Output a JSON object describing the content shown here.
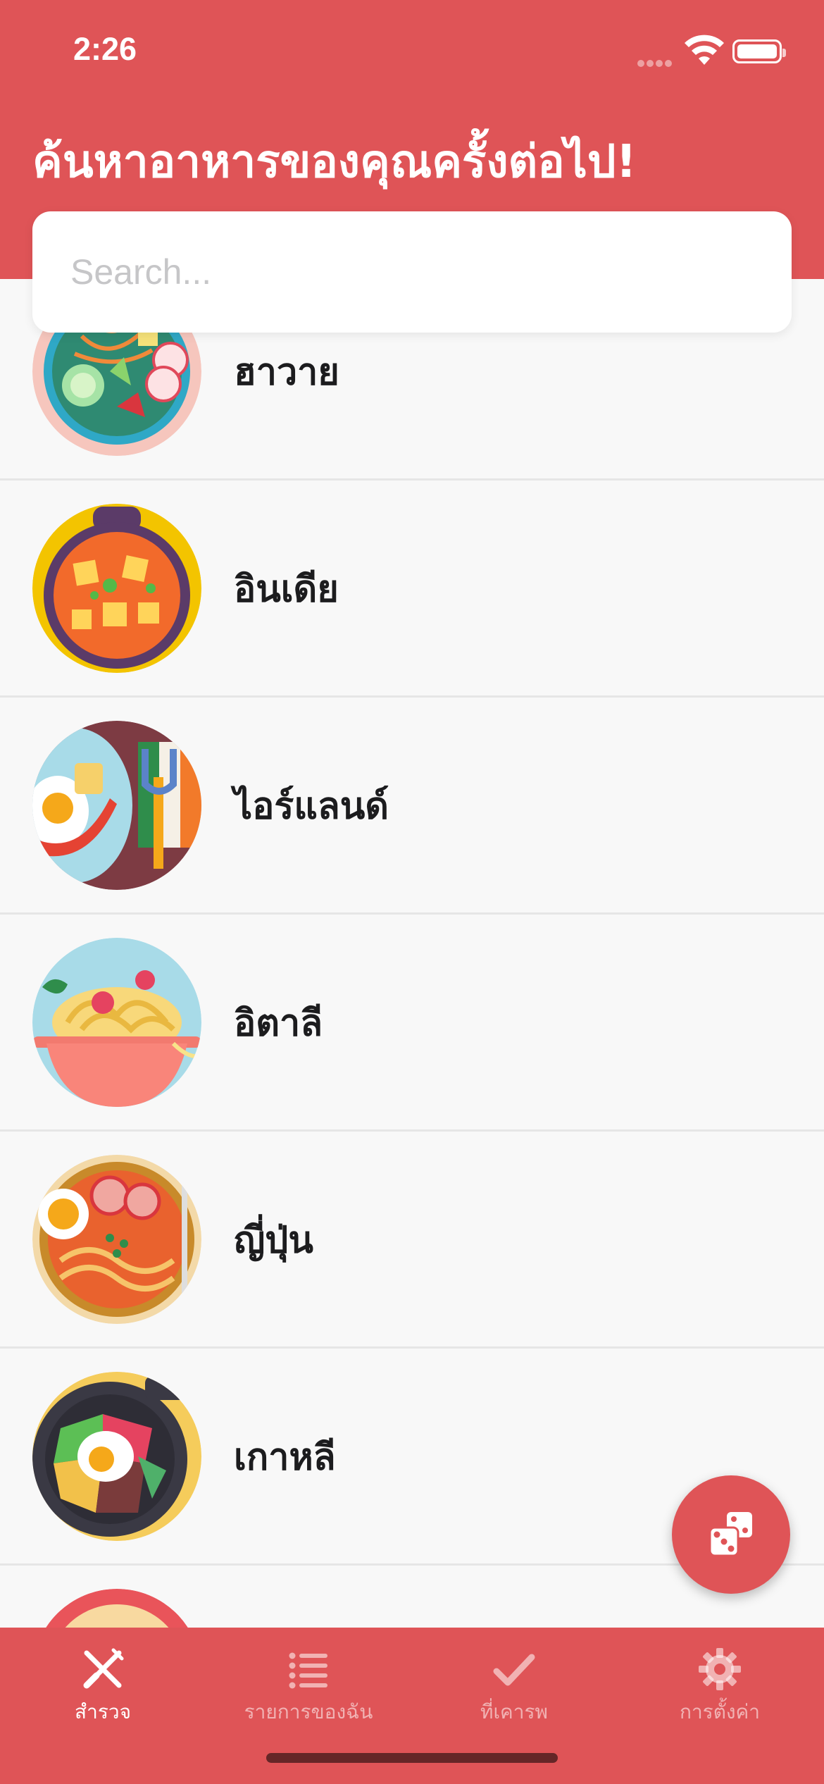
{
  "status_bar": {
    "time": "2:26"
  },
  "header": {
    "title": "ค้นหาอาหารของคุณครั้งต่อไป!"
  },
  "search": {
    "placeholder": "Search...",
    "value": ""
  },
  "cuisines": [
    {
      "label": "ฮาวาย",
      "icon": "poke-bowl-icon"
    },
    {
      "label": "อินเดีย",
      "icon": "curry-pot-icon"
    },
    {
      "label": "ไอร์แลนด์",
      "icon": "breakfast-plate-icon"
    },
    {
      "label": "อิตาลี",
      "icon": "spaghetti-bowl-icon"
    },
    {
      "label": "ญี่ปุ่น",
      "icon": "ramen-bowl-icon"
    },
    {
      "label": "เกาหลี",
      "icon": "bibimbap-bowl-icon"
    }
  ],
  "fab": {
    "icon": "dice-icon"
  },
  "tab_bar": {
    "tabs": [
      {
        "label": "สำรวจ",
        "icon": "fork-knife-icon",
        "active": true
      },
      {
        "label": "รายการของฉัน",
        "icon": "list-icon",
        "active": false
      },
      {
        "label": "ที่เคารพ",
        "icon": "checkmark-icon",
        "active": false
      },
      {
        "label": "การตั้งค่า",
        "icon": "gear-icon",
        "active": false
      }
    ]
  },
  "colors": {
    "accent": "#df5457",
    "background": "#f8f8f8",
    "text": "#1c1c1e"
  }
}
